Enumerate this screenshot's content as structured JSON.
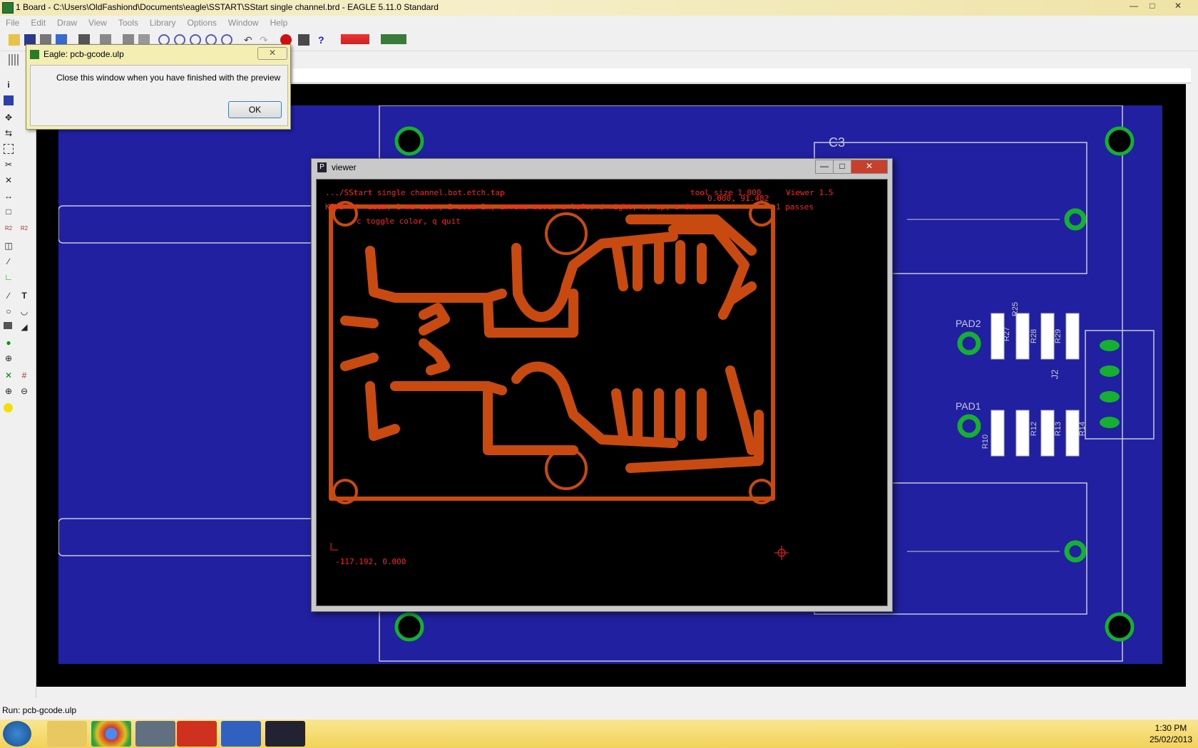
{
  "window": {
    "title": "1 Board - C:\\Users\\OldFashiond\\Documents\\eagle\\SSTART\\SStart single channel.brd - EAGLE 5.11.0 Standard"
  },
  "menu": [
    "File",
    "Edit",
    "Draw",
    "View",
    "Tools",
    "Library",
    "Options",
    "Window",
    "Help"
  ],
  "dialog": {
    "title": "Eagle: pcb-gcode.ulp",
    "message": "Close this window when you have finished with the preview",
    "ok_label": "OK"
  },
  "viewer": {
    "title": "viewer",
    "file_line": ".../SStart single channel.bot.etch.tap",
    "tool_size": "tool size 1.000",
    "coord_top": "0.000, 91.482",
    "viewer_version": "Viewer 1.5",
    "keys_line1": "KEYS +/- zoom, 1 no zoom, 2 zoom 2x, arrows move, a left, d right, w, up, s down",
    "passes": "1 passes",
    "keys_line2": "c toggle color, q quit",
    "coord_bottom": "-117.192, 0.000"
  },
  "board_labels": {
    "c3": "C3",
    "pad2": "PAD2",
    "pad1": "PAD1",
    "r27": "R27",
    "r25": "R25",
    "r28": "R28",
    "r29": "R29",
    "r10": "R10",
    "r12": "R12",
    "r13": "R13",
    "r14": "R14",
    "j2": "J2"
  },
  "status_text": "Run: pcb-gcode.ulp",
  "clock": {
    "time": "1:30 PM",
    "date": "25/02/2013"
  },
  "colors": {
    "board": "#2020a0",
    "trace": "#d24a0a",
    "pad_green": "#16b030",
    "viewer_text": "#ff2020"
  }
}
